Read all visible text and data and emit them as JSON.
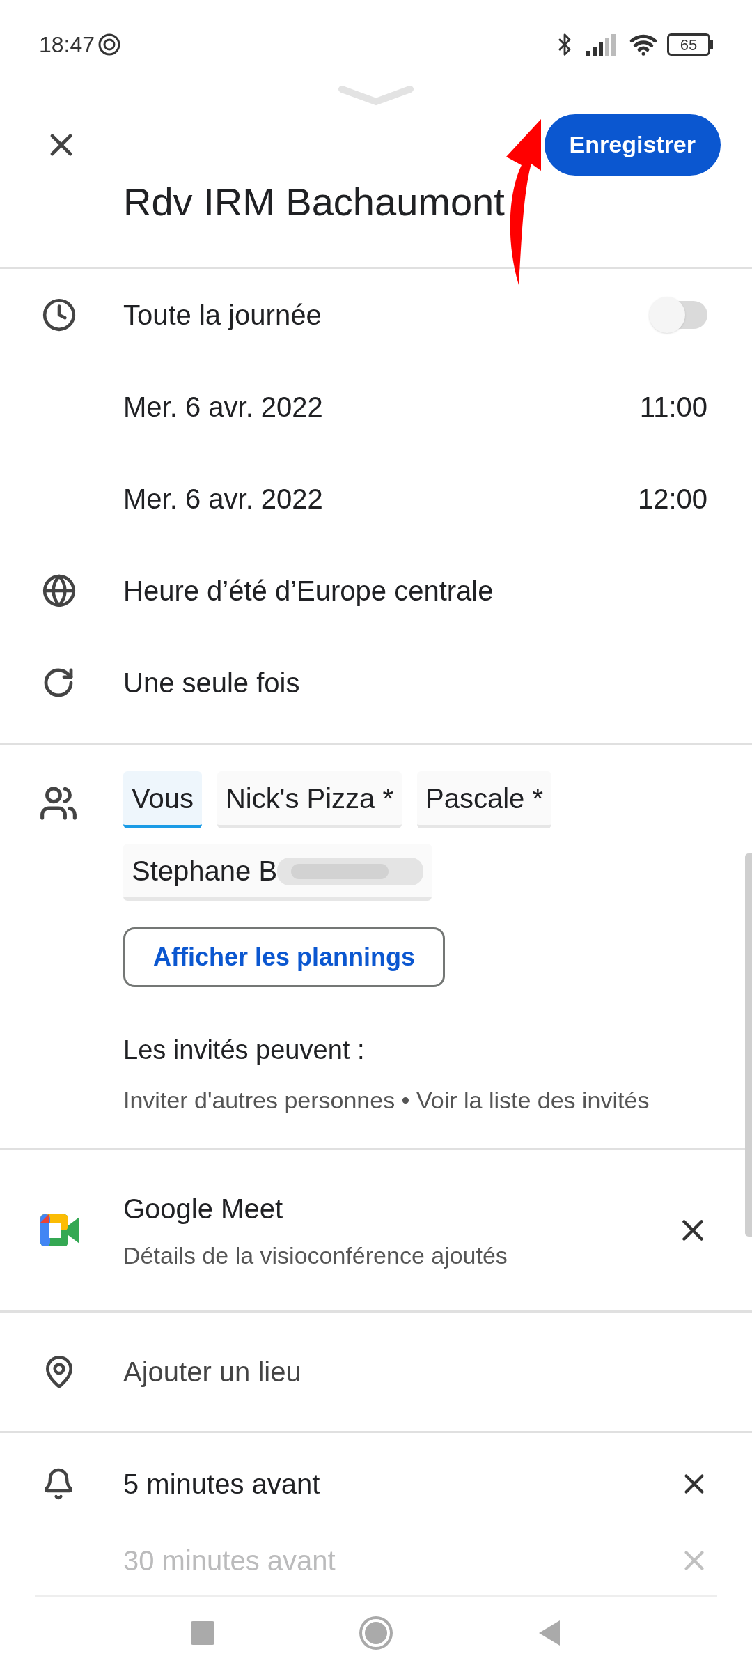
{
  "status_bar": {
    "time": "18:47",
    "battery": "65"
  },
  "header": {
    "save_button": "Enregistrer",
    "title": "Rdv IRM Bachaumont"
  },
  "all_day": {
    "label": "Toute la journée",
    "on": false
  },
  "start": {
    "date": "Mer. 6 avr. 2022",
    "time": "11:00"
  },
  "end": {
    "date": "Mer. 6 avr. 2022",
    "time": "12:00"
  },
  "timezone": "Heure d’été d’Europe centrale",
  "repeat": "Une seule fois",
  "guests": [
    {
      "name": "Vous",
      "selected": true,
      "redacted": false
    },
    {
      "name": "Nick's Pizza *",
      "selected": false,
      "redacted": false
    },
    {
      "name": "Pascale *",
      "selected": false,
      "redacted": false
    },
    {
      "name": "Stephane B",
      "selected": false,
      "redacted": true
    }
  ],
  "schedules_button": "Afficher les plannings",
  "permissions": {
    "title": "Les invités peuvent :",
    "text": "Inviter d'autres personnes • Voir la liste des invités"
  },
  "conference": {
    "title": "Google Meet",
    "subtitle": "Détails de la visioconférence ajoutés"
  },
  "location": {
    "placeholder": "Ajouter un lieu"
  },
  "reminders": [
    "5 minutes avant",
    "30 minutes avant"
  ]
}
